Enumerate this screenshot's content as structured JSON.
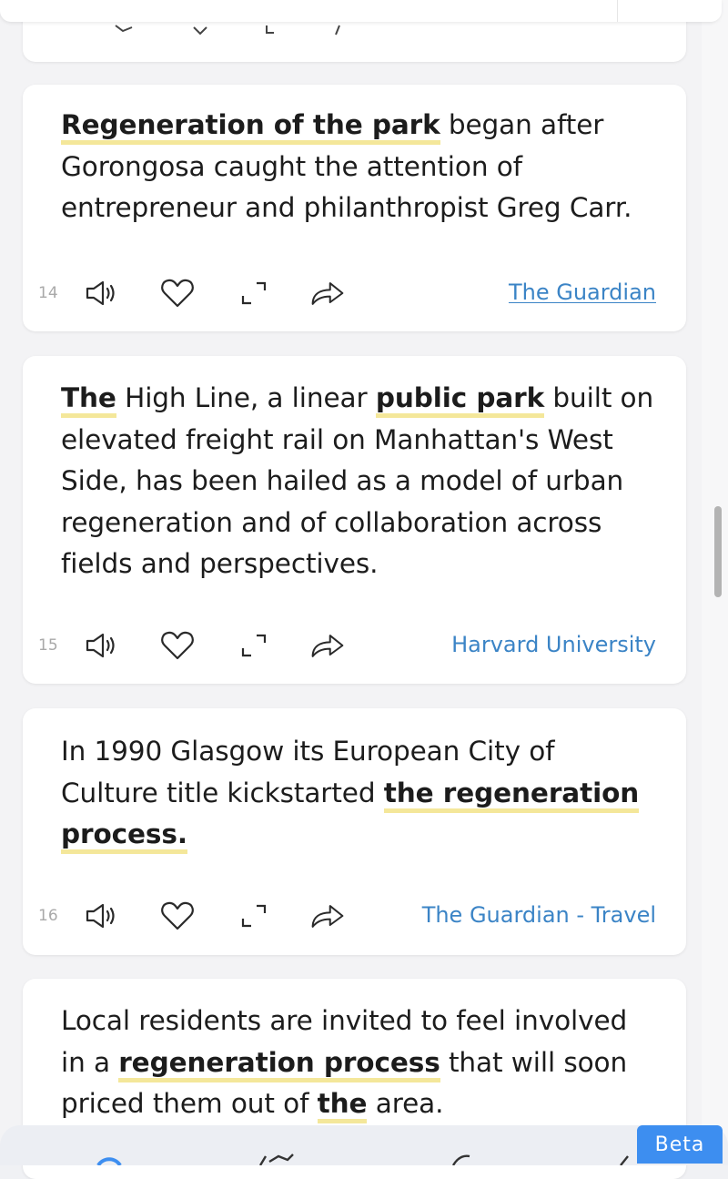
{
  "cards": [
    {
      "number": "14",
      "text_before": "",
      "b1": "Regeneration of the park",
      "text_a": " began after Gorongosa caught the attention of entrepreneur and philanthropist Greg Carr.",
      "source": "The Guardian"
    },
    {
      "number": "15",
      "b1": "The",
      "text_a": " High Line, a linear ",
      "b2": "public park",
      "text_b": " built on elevated freight rail on Manhattan's West Side, has been hailed as a model of urban regeneration and of collaboration across fields and perspectives.",
      "source": "Harvard University"
    },
    {
      "number": "16",
      "text_before": "In 1990 Glasgow its European City of Culture title kickstarted ",
      "b1": "the regeneration process.",
      "source": "The Guardian - Travel"
    },
    {
      "text_before": "Local residents are invited to feel involved in a ",
      "b1": "regeneration process",
      "text_a": " that will soon priced them out of ",
      "b2": "the",
      "text_b": " area."
    }
  ],
  "icons": {
    "speaker": "speaker-icon",
    "heart": "heart-icon",
    "expand": "expand-icon",
    "share": "share-icon"
  },
  "beta_label": "Beta",
  "colors": {
    "link": "#3b84c6",
    "highlight": "#f4e79a",
    "beta": "#3d8ef0"
  }
}
